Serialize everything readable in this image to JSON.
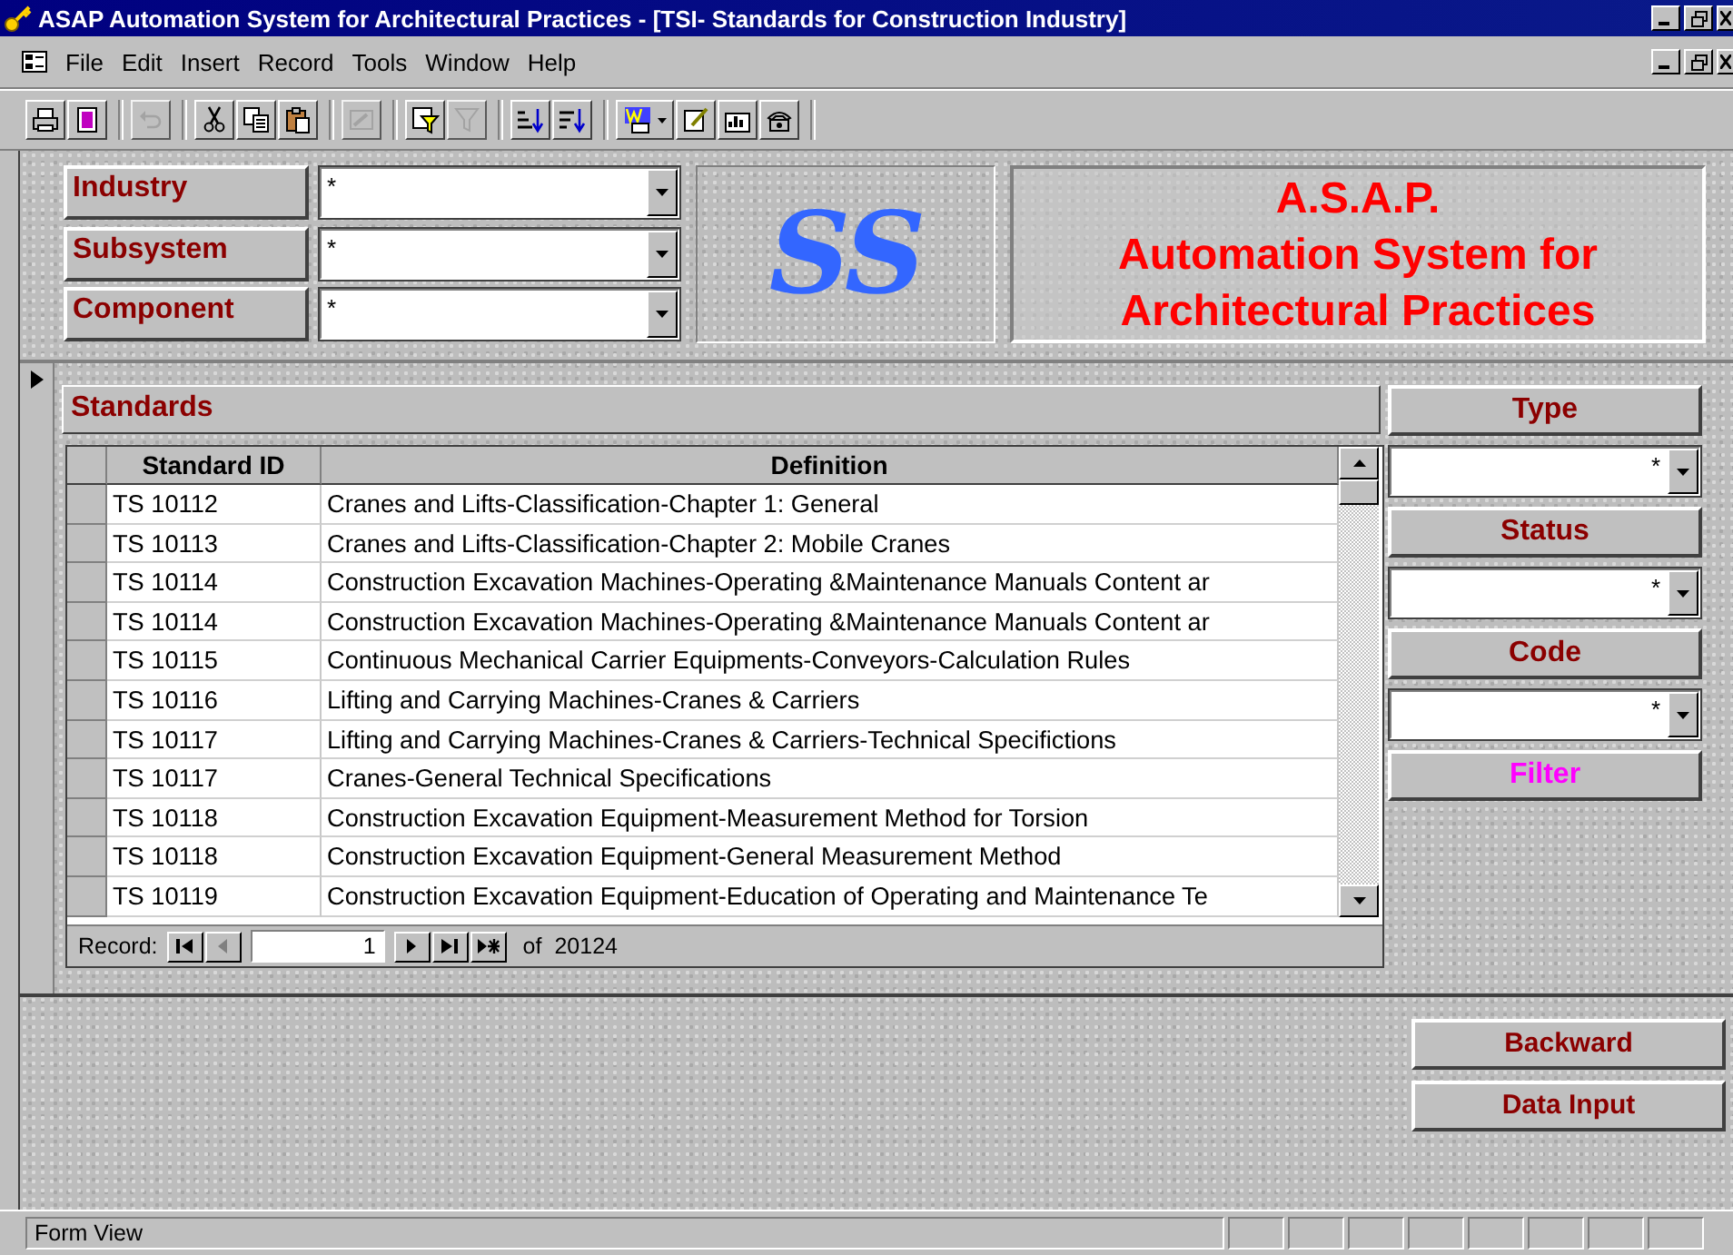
{
  "window": {
    "title": "ASAP Automation System for Architectural Practices - [TSI- Standards for Construction Industry]"
  },
  "menu_bar": {
    "items": [
      "File",
      "Edit",
      "Insert",
      "Record",
      "Tools",
      "Window",
      "Help"
    ]
  },
  "toolbar": [
    {
      "kind": "print",
      "disabled": false
    },
    {
      "kind": "preview",
      "disabled": false
    },
    {
      "kind": "undo",
      "disabled": true
    },
    {
      "kind": "cut",
      "disabled": false
    },
    {
      "kind": "copy",
      "disabled": false
    },
    {
      "kind": "paste",
      "disabled": false
    },
    {
      "kind": "format",
      "disabled": true
    },
    {
      "kind": "filter-form",
      "disabled": false
    },
    {
      "kind": "filter",
      "disabled": true
    },
    {
      "kind": "sort-asc",
      "disabled": false
    },
    {
      "kind": "sort-desc",
      "disabled": false
    },
    {
      "kind": "links",
      "disabled": false
    },
    {
      "kind": "edit",
      "disabled": false
    },
    {
      "kind": "chart",
      "disabled": false
    },
    {
      "kind": "phone",
      "disabled": false
    }
  ],
  "filters": [
    {
      "label": "Industry",
      "value": "*"
    },
    {
      "label": "Subsystem",
      "value": "*"
    },
    {
      "label": "Component",
      "value": "*"
    }
  ],
  "logo": {
    "text": "SS"
  },
  "banner": {
    "lines": [
      "A.S.A.P.",
      "Automation System for",
      "Architectural Practices"
    ]
  },
  "standards": {
    "title": "Standards",
    "columns": [
      "Standard ID",
      "Definition"
    ],
    "rows": [
      {
        "id": "TS 10112",
        "definition": "Cranes and Lifts-Classification-Chapter 1: General"
      },
      {
        "id": "TS 10113",
        "definition": "Cranes and Lifts-Classification-Chapter 2: Mobile Cranes"
      },
      {
        "id": "TS 10114",
        "definition": "Construction Excavation Machines-Operating &Maintenance Manuals Content ar"
      },
      {
        "id": "TS 10114",
        "definition": "Construction Excavation Machines-Operating &Maintenance Manuals Content ar"
      },
      {
        "id": "TS 10115",
        "definition": "Continuous Mechanical Carrier Equipments-Conveyors-Calculation Rules"
      },
      {
        "id": "TS 10116",
        "definition": "Lifting and Carrying Machines-Cranes & Carriers"
      },
      {
        "id": "TS 10117",
        "definition": "Lifting and Carrying Machines-Cranes & Carriers-Technical Specifictions"
      },
      {
        "id": "TS 10117",
        "definition": "Cranes-General Technical Specifications"
      },
      {
        "id": "TS 10118",
        "definition": "Construction Excavation Equipment-Measurement Method for Torsion"
      },
      {
        "id": "TS 10118",
        "definition": "Construction Excavation Equipment-General Measurement Method"
      },
      {
        "id": "TS 10119",
        "definition": "Construction Excavation Equipment-Education of Operating and Maintenance Te"
      }
    ],
    "navigator": {
      "label": "Record:",
      "current": "1",
      "of": "of",
      "total": "20124"
    }
  },
  "side_filters": [
    {
      "label": "Type",
      "value": "*"
    },
    {
      "label": "Status",
      "value": "*"
    },
    {
      "label": "Code",
      "value": "*"
    }
  ],
  "filter_button": "Filter",
  "buttons": [
    "Backward",
    "Data Input"
  ],
  "status_bar": {
    "text": "Form View"
  }
}
